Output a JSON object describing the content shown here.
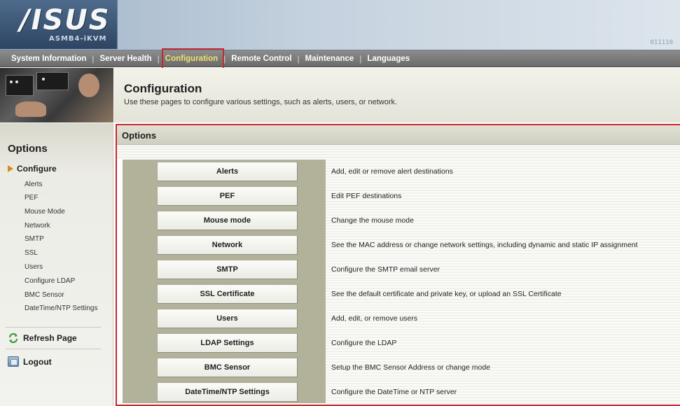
{
  "banner": {
    "logo": "/ISUS",
    "model": "ASMB4-iKVM",
    "binary": "011110"
  },
  "nav": {
    "items": [
      {
        "label": "System Information",
        "active": false
      },
      {
        "label": "Server Health",
        "active": false
      },
      {
        "label": "Configuration",
        "active": true
      },
      {
        "label": "Remote Control",
        "active": false
      },
      {
        "label": "Maintenance",
        "active": false
      },
      {
        "label": "Languages",
        "active": false
      }
    ]
  },
  "page": {
    "title": "Configuration",
    "subtitle": "Use these pages to configure various settings, such as alerts, users, or network."
  },
  "sidebar": {
    "title": "Options",
    "configure_label": "Configure",
    "links": [
      "Alerts",
      "PEF",
      "Mouse Mode",
      "Network",
      "SMTP",
      "SSL",
      "Users",
      "Configure LDAP",
      "BMC Sensor",
      "DateTime/NTP Settings"
    ],
    "refresh_label": "Refresh Page",
    "logout_label": "Logout"
  },
  "options": {
    "header": "Options",
    "rows": [
      {
        "button": "Alerts",
        "description": "Add, edit or remove alert destinations"
      },
      {
        "button": "PEF",
        "description": "Edit PEF destinations"
      },
      {
        "button": "Mouse mode",
        "description": "Change the mouse mode"
      },
      {
        "button": "Network",
        "description": "See the MAC address or change network settings, including dynamic and static IP assignment"
      },
      {
        "button": "SMTP",
        "description": "Configure the SMTP email server"
      },
      {
        "button": "SSL Certificate",
        "description": "See the default certificate and private key, or upload an SSL Certificate"
      },
      {
        "button": "Users",
        "description": "Add, edit, or remove users"
      },
      {
        "button": "LDAP Settings",
        "description": "Configure the LDAP"
      },
      {
        "button": "BMC Sensor",
        "description": "Setup the BMC Sensor Address or change mode"
      },
      {
        "button": "DateTime/NTP Settings",
        "description": "Configure the DateTime or NTP server"
      }
    ]
  },
  "colors": {
    "highlight": "#c8282c",
    "nav_active": "#f0e26a",
    "nav_bg": "#7a7a7a",
    "button_column": "#b2b29a"
  }
}
